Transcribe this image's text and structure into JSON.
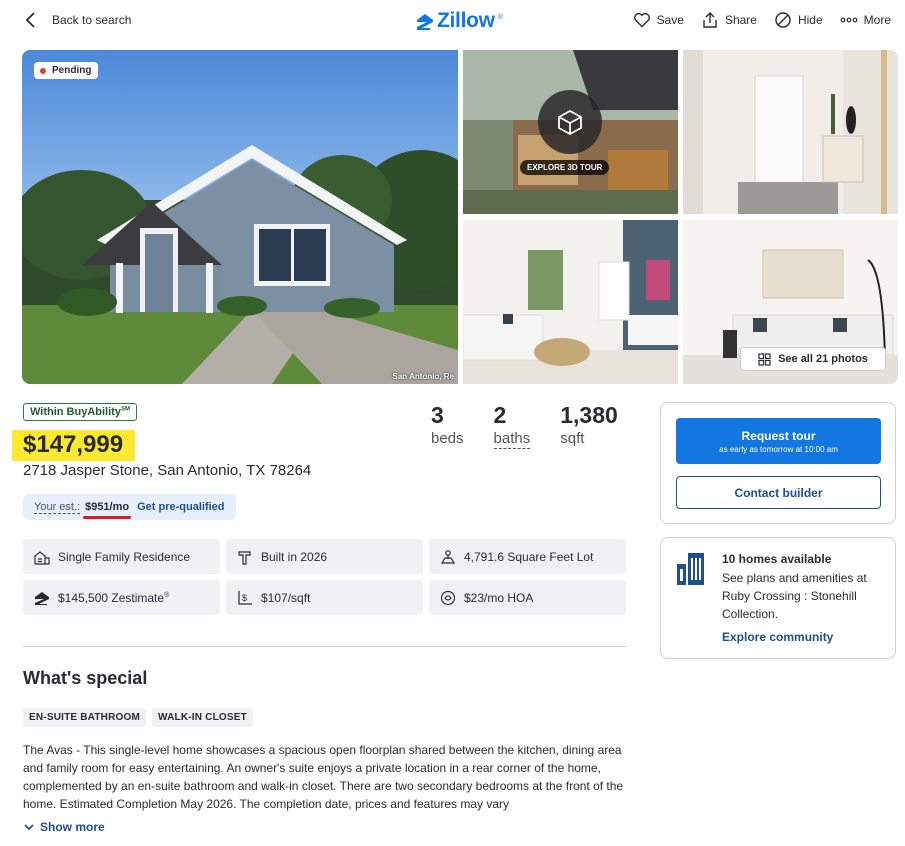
{
  "header": {
    "back_label": "Back to search",
    "logo_text": "Zillow",
    "logo_mark": "®",
    "actions": [
      {
        "label": "Save",
        "icon": "heart-icon"
      },
      {
        "label": "Share",
        "icon": "share-icon"
      },
      {
        "label": "Hide",
        "icon": "hide-icon"
      },
      {
        "label": "More",
        "icon": "more-icon"
      }
    ]
  },
  "gallery": {
    "status_badge": "Pending",
    "watermark": "San Antonio, Re",
    "tour_label": "EXPLORE 3D TOUR",
    "see_all_label": "See all 21 photos"
  },
  "listing": {
    "buyability": "Within BuyAbility",
    "buyability_mark": "SM",
    "price": "$147,999",
    "address": "2718 Jasper Stone, San Antonio, TX 78264",
    "stats": [
      {
        "value": "3",
        "label": "beds"
      },
      {
        "value": "2",
        "label": "baths"
      },
      {
        "value": "1,380",
        "label": "sqft"
      }
    ],
    "estimate": {
      "label": "Your est.:",
      "value": "$951/mo",
      "link": "Get pre-qualified"
    },
    "facts": [
      {
        "icon": "house-type-icon",
        "text": "Single Family Residence"
      },
      {
        "icon": "hammer-icon",
        "text": "Built in 2026"
      },
      {
        "icon": "lot-size-icon",
        "text": "4,791.6 Square Feet Lot"
      },
      {
        "icon": "zestimate-icon",
        "text": "$145,500 Zestimate",
        "sup": "®"
      },
      {
        "icon": "price-per-sqft-icon",
        "text": "$107/sqft"
      },
      {
        "icon": "hoa-icon",
        "text": "$23/mo HOA"
      }
    ]
  },
  "special": {
    "title": "What's special",
    "tags": [
      "EN-SUITE BATHROOM",
      "WALK-IN CLOSET"
    ],
    "description": "The Avas - This single-level home showcases a spacious open floorplan shared between the kitchen, dining area and family room for easy entertaining. An owner's suite enjoys a private location in a rear corner of the home, complemented by an en-suite bathroom and walk-in closet. There are two secondary bedrooms at the front of the home. Estimated Completion May 2026. The completion date, prices and features may vary",
    "show_more": "Show more"
  },
  "tour_card": {
    "request_label": "Request tour",
    "request_sub": "as early as tomorrow at 10:00 am",
    "contact_label": "Contact builder"
  },
  "community_card": {
    "title": "10 homes available",
    "description": "See plans and amenities at Ruby Crossing : Stonehill Collection.",
    "link": "Explore community"
  },
  "colors": {
    "brand_blue": "#1277e1",
    "link_navy": "#1f4f8f",
    "price_highlight": "#fde92f",
    "underline_red": "#d91c2c",
    "pending_dot": "#e0422b"
  }
}
